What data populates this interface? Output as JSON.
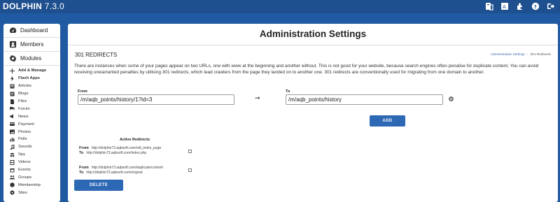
{
  "app": {
    "name": "DOLPHIN",
    "version": "7.3.0"
  },
  "top_icons": [
    "view-site-icon",
    "language-icon",
    "extensions-icon",
    "help-icon",
    "logout-icon"
  ],
  "sidebar": {
    "top_items": [
      {
        "label": "Dashboard",
        "icon": "dashboard-icon"
      },
      {
        "label": "Members",
        "icon": "members-icon"
      },
      {
        "label": "Modules",
        "icon": "modules-icon"
      }
    ],
    "module_items": [
      {
        "label": "Add & Manage",
        "icon": "plus-icon",
        "bold": true
      },
      {
        "label": "Flash Apps",
        "icon": "bolt-icon",
        "bold": true
      },
      {
        "label": "Articles",
        "icon": "articles-icon"
      },
      {
        "label": "Blogs",
        "icon": "blogs-icon"
      },
      {
        "label": "Files",
        "icon": "files-icon"
      },
      {
        "label": "Forum",
        "icon": "forum-icon"
      },
      {
        "label": "News",
        "icon": "news-icon"
      },
      {
        "label": "Payment",
        "icon": "payment-icon"
      },
      {
        "label": "Photos",
        "icon": "photos-icon"
      },
      {
        "label": "Polls",
        "icon": "polls-icon"
      },
      {
        "label": "Sounds",
        "icon": "sounds-icon"
      },
      {
        "label": "Spy",
        "icon": "spy-icon"
      },
      {
        "label": "Videos",
        "icon": "videos-icon"
      },
      {
        "label": "Events",
        "icon": "events-icon"
      },
      {
        "label": "Groups",
        "icon": "groups-icon"
      },
      {
        "label": "Membership",
        "icon": "membership-icon"
      },
      {
        "label": "Sites",
        "icon": "sites-icon"
      }
    ]
  },
  "main": {
    "page_title": "Administration Settings",
    "section_title": "301 REDIRECTS",
    "breadcrumb": {
      "link": "Administration Settings",
      "separator": "›",
      "current": "301 Redirects"
    },
    "description": "There are instances when some of your pages appear on two URLs, one with www at the beginning and another without. This is not good for your website, because search engines often penalise for duplicate content. You can avoid receiving unwarranted penalties by utilising 301 redirects, which lead crawlers from the page they landed on to another one. 301 redirects are conventionally used for migrating from one domain to another.",
    "from_label": "From",
    "from_value": "/m/aqb_points/history/1?id=3",
    "to_label": "To",
    "to_value": "/m/aqb_points/history",
    "arrow": "➞",
    "add_label": "ADD",
    "active_title": "Active Redirects",
    "redirects": [
      {
        "from_label": "From",
        "from": "http://dolphin73.aqbsoft.com/old_index_page",
        "to_label": "To",
        "to": "http://dolphin73.aqbsoft.com/index.php"
      },
      {
        "from_label": "From",
        "from": "http://dolphin73.aqbsoft.com/duplicate/content",
        "to_label": "To",
        "to": "http://dolphin73.aqbsoft.com/original"
      }
    ],
    "delete_label": "DELETE"
  },
  "colors": {
    "background": "#1f5aa3",
    "topbar": "#1e4f8e",
    "button": "#2d68b5",
    "link": "#3d6db5"
  }
}
